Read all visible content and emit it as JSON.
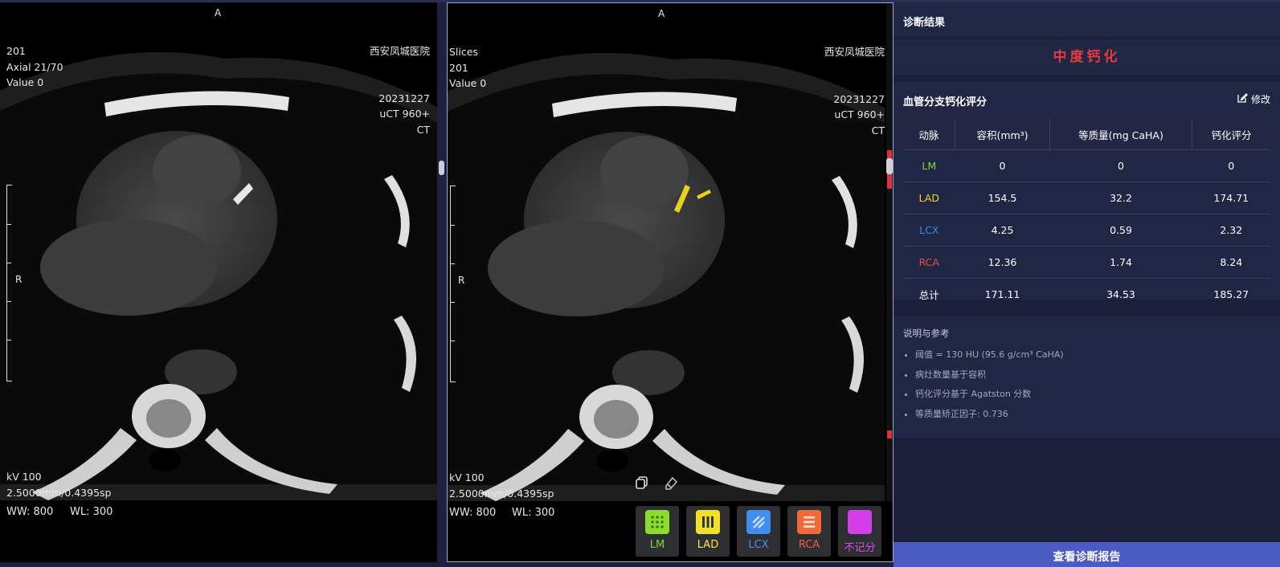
{
  "viewer_left": {
    "orientation_top": "A",
    "orientation_left": "R",
    "top_left": [
      "201",
      "Axial 21/70",
      "Value 0"
    ],
    "top_right": [
      "西安凤城医院",
      "",
      "",
      "20231227",
      "uCT 960+",
      "CT"
    ],
    "bottom_left": [
      "kV 100",
      "2.5000mm/0.4395sp"
    ],
    "ww": "WW: 800",
    "wl": "WL: 300"
  },
  "viewer_right": {
    "orientation_top": "A",
    "orientation_left": "R",
    "top_left": [
      "Slices",
      "201",
      "Value 0"
    ],
    "top_right": [
      "西安凤城医院",
      "",
      "",
      "20231227",
      "uCT 960+",
      "CT"
    ],
    "bottom_left": [
      "kV 100",
      "2.5000mm/0.4395sp"
    ],
    "ww": "WW: 800",
    "wl": "WL: 300",
    "tools": [
      "copy-icon",
      "eraser-icon"
    ],
    "label_buttons": [
      {
        "label": "LM",
        "color": "#8bdc2c",
        "text_color": "#7fd83a",
        "icon": "dots-grid-icon"
      },
      {
        "label": "LAD",
        "color": "#f0e02a",
        "text_color": "#ffe34a",
        "icon": "vertical-bars-icon"
      },
      {
        "label": "LCX",
        "color": "#3f8ef0",
        "text_color": "#4f8ff5",
        "icon": "diagonal-stripes-icon"
      },
      {
        "label": "RCA",
        "color": "#f06a3a",
        "text_color": "#f25a44",
        "icon": "horizontal-bars-icon"
      },
      {
        "label": "不记分",
        "color": "#d33ee8",
        "text_color": "#d84ef0",
        "icon": "solid-square-icon"
      }
    ]
  },
  "panel": {
    "diagnosis_title": "诊断结果",
    "diagnosis_result": "中度钙化",
    "score_title": "血管分支钙化评分",
    "edit_label": "修改",
    "table": {
      "headers": [
        "动脉",
        "容积(mm³)",
        "等质量(mg CaHA)",
        "钙化评分"
      ],
      "rows": [
        {
          "name": "LM",
          "color": "#7fd83a",
          "volume": "0",
          "mass": "0",
          "score": "0"
        },
        {
          "name": "LAD",
          "color": "#f2d32a",
          "volume": "154.5",
          "mass": "32.2",
          "score": "174.71"
        },
        {
          "name": "LCX",
          "color": "#3d86f0",
          "volume": "4.25",
          "mass": "0.59",
          "score": "2.32"
        },
        {
          "name": "RCA",
          "color": "#f04a3c",
          "volume": "12.36",
          "mass": "1.74",
          "score": "8.24"
        },
        {
          "name": "总计",
          "color": "#ffffff",
          "volume": "171.11",
          "mass": "34.53",
          "score": "185.27"
        }
      ]
    },
    "notes_title": "说明与参考",
    "notes": [
      "阈值 = 130 HU (95.6 g/cm³ CaHA)",
      "病灶数量基于容积",
      "钙化评分基于 Agatston 分数",
      "等质量矫正因子: 0.736"
    ],
    "report_button": "查看诊断报告"
  }
}
